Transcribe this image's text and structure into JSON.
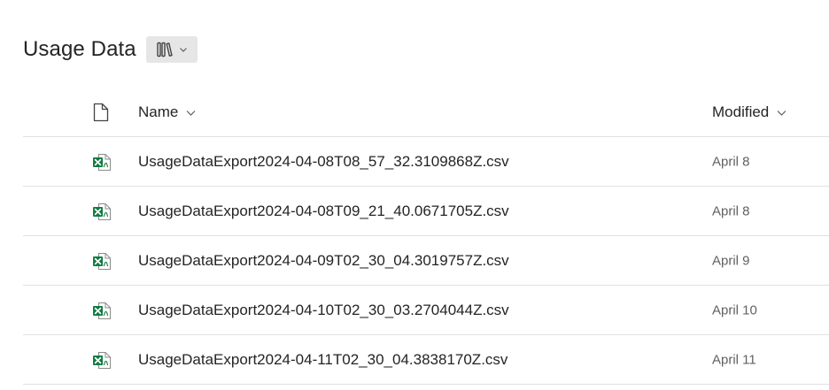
{
  "library": {
    "title": "Usage Data",
    "view_switcher_icon": "library-icon",
    "view_switcher_chevron": "chevron-down-icon"
  },
  "columns": {
    "type_icon": "document-icon",
    "name": "Name",
    "modified": "Modified"
  },
  "files": [
    {
      "name": "UsageDataExport2024-04-08T08_57_32.3109868Z.csv",
      "modified": "April 8",
      "icon": "excel-csv-icon"
    },
    {
      "name": "UsageDataExport2024-04-08T09_21_40.0671705Z.csv",
      "modified": "April 8",
      "icon": "excel-csv-icon"
    },
    {
      "name": "UsageDataExport2024-04-09T02_30_04.3019757Z.csv",
      "modified": "April 9",
      "icon": "excel-csv-icon"
    },
    {
      "name": "UsageDataExport2024-04-10T02_30_03.2704044Z.csv",
      "modified": "April 10",
      "icon": "excel-csv-icon"
    },
    {
      "name": "UsageDataExport2024-04-11T02_30_04.3838170Z.csv",
      "modified": "April 11",
      "icon": "excel-csv-icon"
    }
  ],
  "colors": {
    "excel_green": "#107c41",
    "divider": "#e1e1e1",
    "switcher_bg": "#e6e6e6"
  }
}
